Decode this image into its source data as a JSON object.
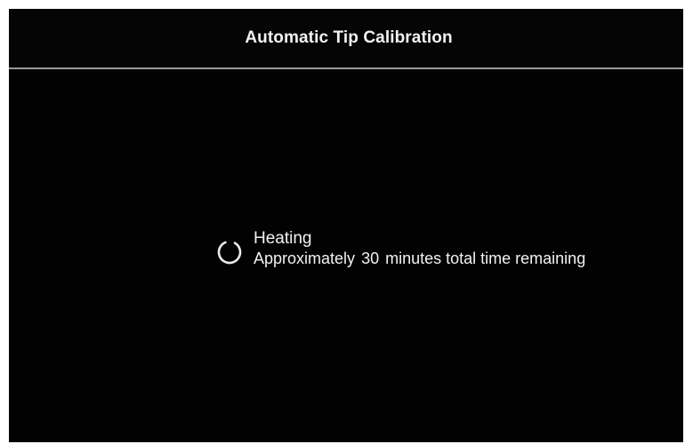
{
  "header": {
    "title": "Automatic Tip Calibration"
  },
  "status": {
    "icon": "spinner-icon",
    "heading": "Heating",
    "detail_prefix": "Approximately",
    "minutes": "30",
    "detail_suffix": "minutes total time remaining"
  },
  "colors": {
    "background": "#020202",
    "text": "#f2f2f2",
    "divider": "#9a9a9a"
  }
}
